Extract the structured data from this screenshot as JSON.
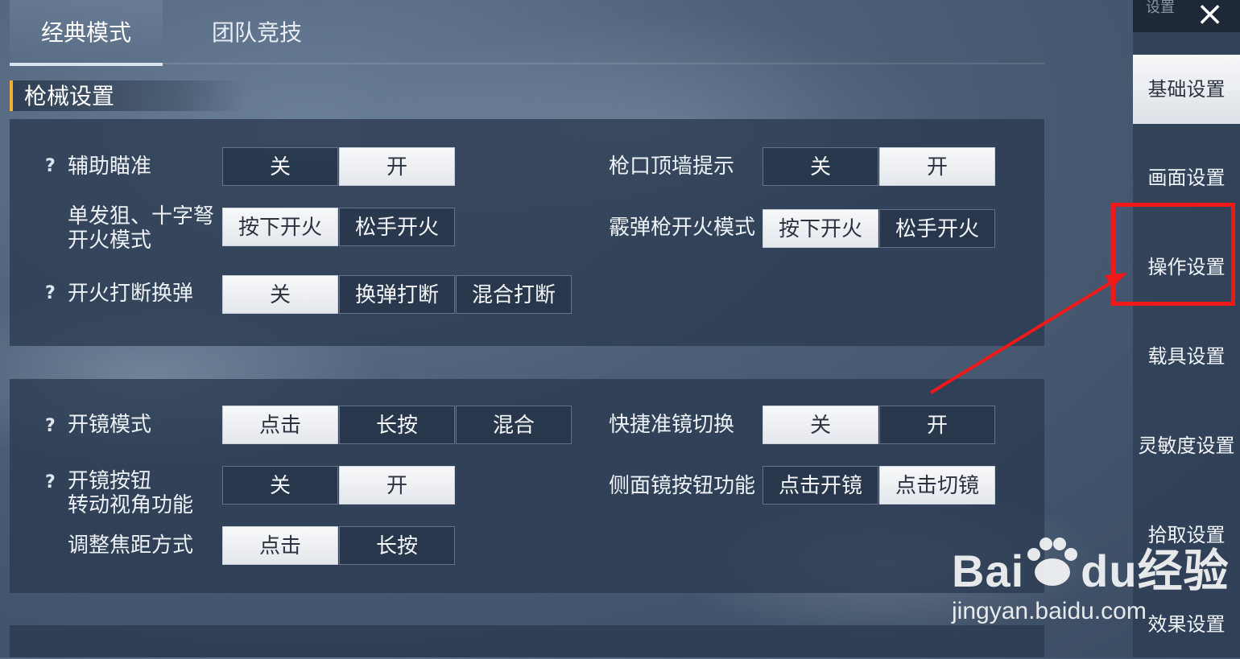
{
  "tabs": [
    {
      "label": "经典模式",
      "active": true
    },
    {
      "label": "团队竞技",
      "active": false
    }
  ],
  "section": {
    "title": "枪械设置"
  },
  "panel1": {
    "rows": [
      {
        "help": "?",
        "label": "辅助瞄准",
        "options": [
          "关",
          "开"
        ],
        "selected": 1
      },
      {
        "label_line1": "单发狙、十字弩",
        "label_line2": "开火模式",
        "options": [
          "按下开火",
          "松手开火"
        ],
        "selected": 0
      },
      {
        "help": "?",
        "label": "开火打断换弹",
        "options": [
          "关",
          "换弹打断",
          "混合打断"
        ],
        "selected": 0
      },
      {
        "label": "枪口顶墙提示",
        "options": [
          "关",
          "开"
        ],
        "selected": 1
      },
      {
        "label": "霰弹枪开火模式",
        "options": [
          "按下开火",
          "松手开火"
        ],
        "selected": 0
      }
    ]
  },
  "panel2": {
    "rows": [
      {
        "help": "?",
        "label": "开镜模式",
        "options": [
          "点击",
          "长按",
          "混合"
        ],
        "selected": 0
      },
      {
        "help": "?",
        "label_line1": "开镜按钮",
        "label_line2": "转动视角功能",
        "options": [
          "关",
          "开"
        ],
        "selected": 1
      },
      {
        "label": "调整焦距方式",
        "options": [
          "点击",
          "长按"
        ],
        "selected": 0
      },
      {
        "label": "快捷准镜切换",
        "options": [
          "关",
          "开"
        ],
        "selected": 0
      },
      {
        "label": "侧面镜按钮功能",
        "options": [
          "点击开镜",
          "点击切镜"
        ],
        "selected": 1
      }
    ]
  },
  "sidebar": {
    "title": "设置",
    "close_icon": "×",
    "items": [
      {
        "label": "基础设置",
        "active": true
      },
      {
        "label": "画面设置",
        "active": false
      },
      {
        "label": "操作设置",
        "active": false,
        "highlighted": true
      },
      {
        "label": "载具设置",
        "active": false
      },
      {
        "label": "灵敏度设置",
        "active": false
      },
      {
        "label": "拾取设置",
        "active": false
      },
      {
        "label": "效果设置",
        "active": false
      }
    ]
  },
  "annotation": {
    "color": "#f01818"
  },
  "watermark": {
    "brand_left": "Bai",
    "brand_mid": "du",
    "brand_right": "经验",
    "url": "jingyan.baidu.com"
  }
}
